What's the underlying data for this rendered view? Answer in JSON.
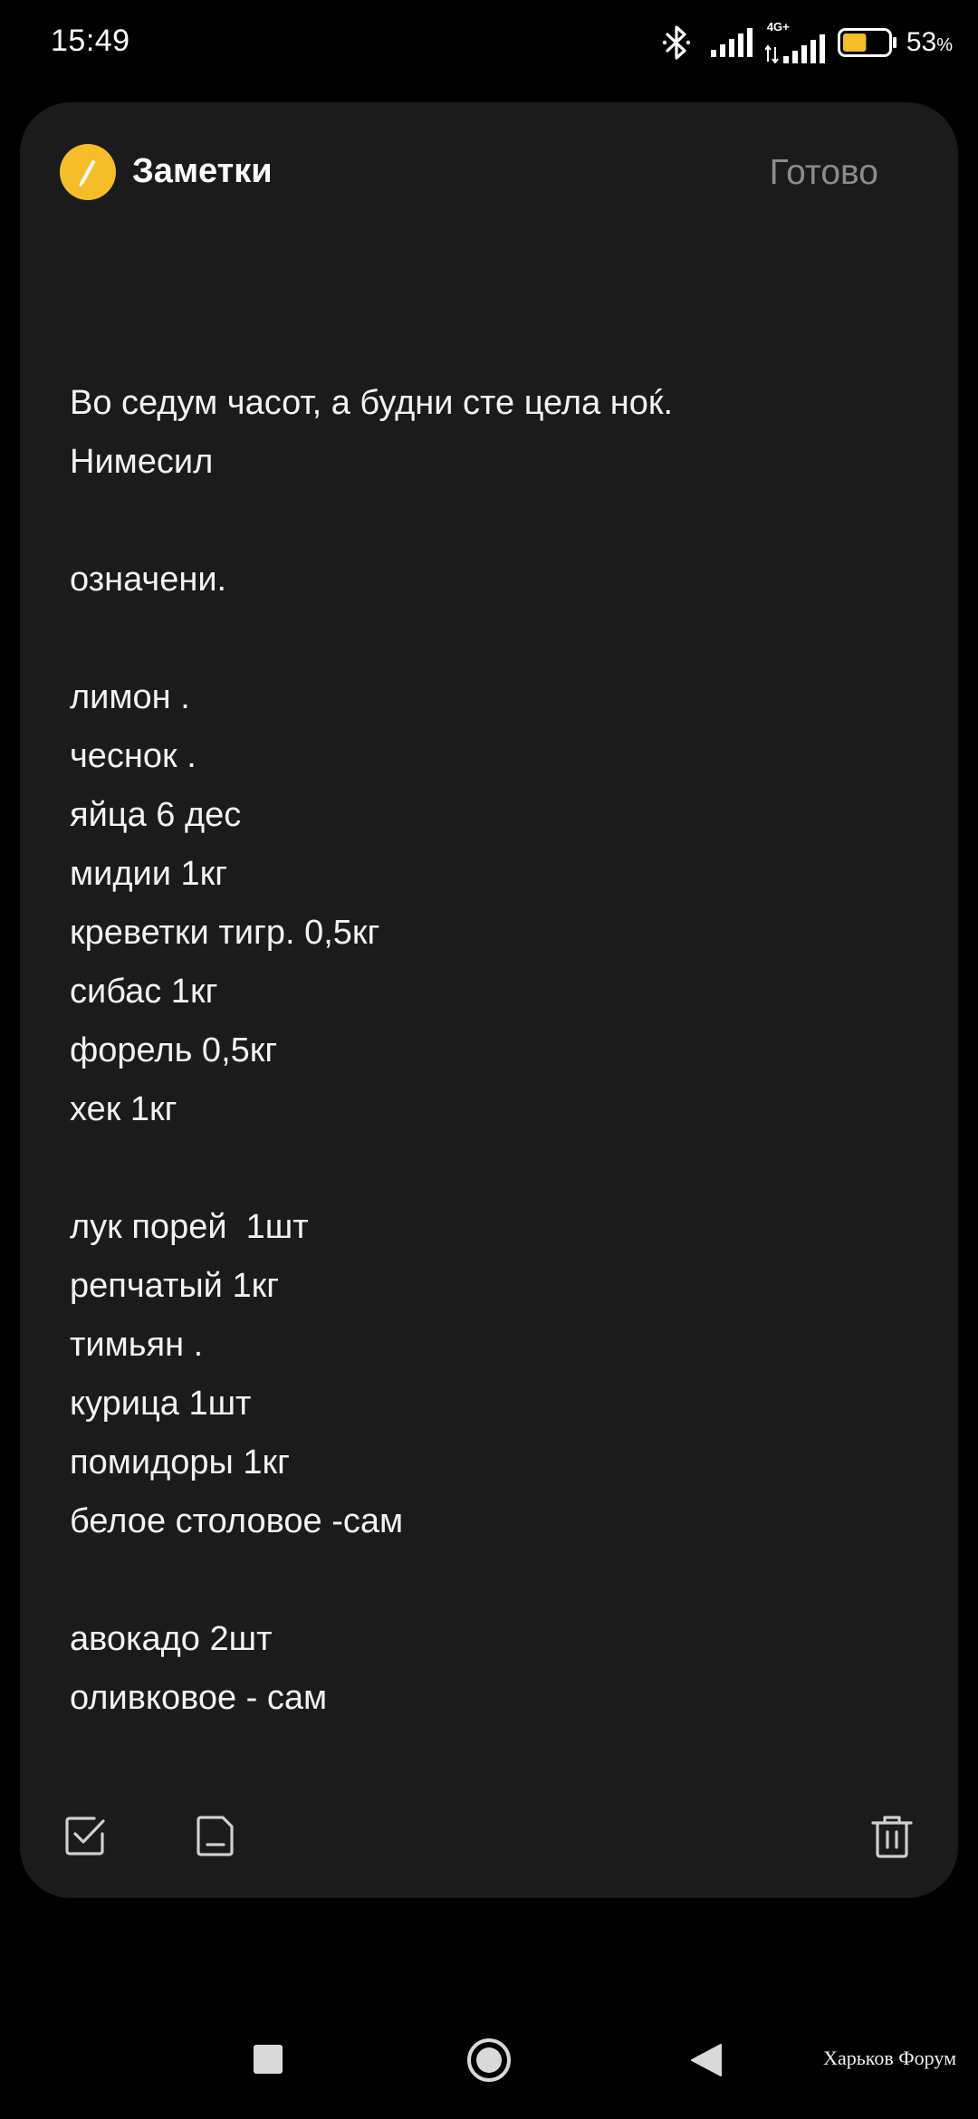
{
  "status_bar": {
    "time": "15:49",
    "network_type": "4G+",
    "battery_percent": "53",
    "battery_unit": "%",
    "battery_level": 0.53,
    "battery_color": "#f5bd28",
    "icons": [
      "bluetooth-icon",
      "signal-icon",
      "mobile-data-signal-icon",
      "battery-icon"
    ]
  },
  "header": {
    "app_icon": "pencil-icon",
    "app_icon_color": "#f5bd28",
    "title": "Заметки",
    "done_label": "Готово"
  },
  "note": {
    "lines": [
      "Во седум часот, а будни сте цела ноќ.",
      "Нимесил",
      "",
      "означени.",
      "",
      "лимон .",
      "чеснок .",
      "яйца 6 дес",
      "мидии 1кг",
      "креветки тигр. 0,5кг",
      "сибас 1кг",
      "форель 0,5кг",
      "хек 1кг",
      "",
      "лук порей  1шт",
      "репчатый 1кг",
      "тимьян .",
      "курица 1шт",
      "помидоры 1кг",
      "белое столовое -сам",
      "",
      "авокадо 2шт",
      "оливковое - сам"
    ]
  },
  "toolbar": {
    "icons": [
      "checklist-icon",
      "note-format-icon",
      "trash-icon"
    ]
  },
  "nav_bar": {
    "icons": [
      "recents-square-icon",
      "home-circle-icon",
      "back-triangle-icon"
    ]
  },
  "watermark": "Харьков Форум"
}
